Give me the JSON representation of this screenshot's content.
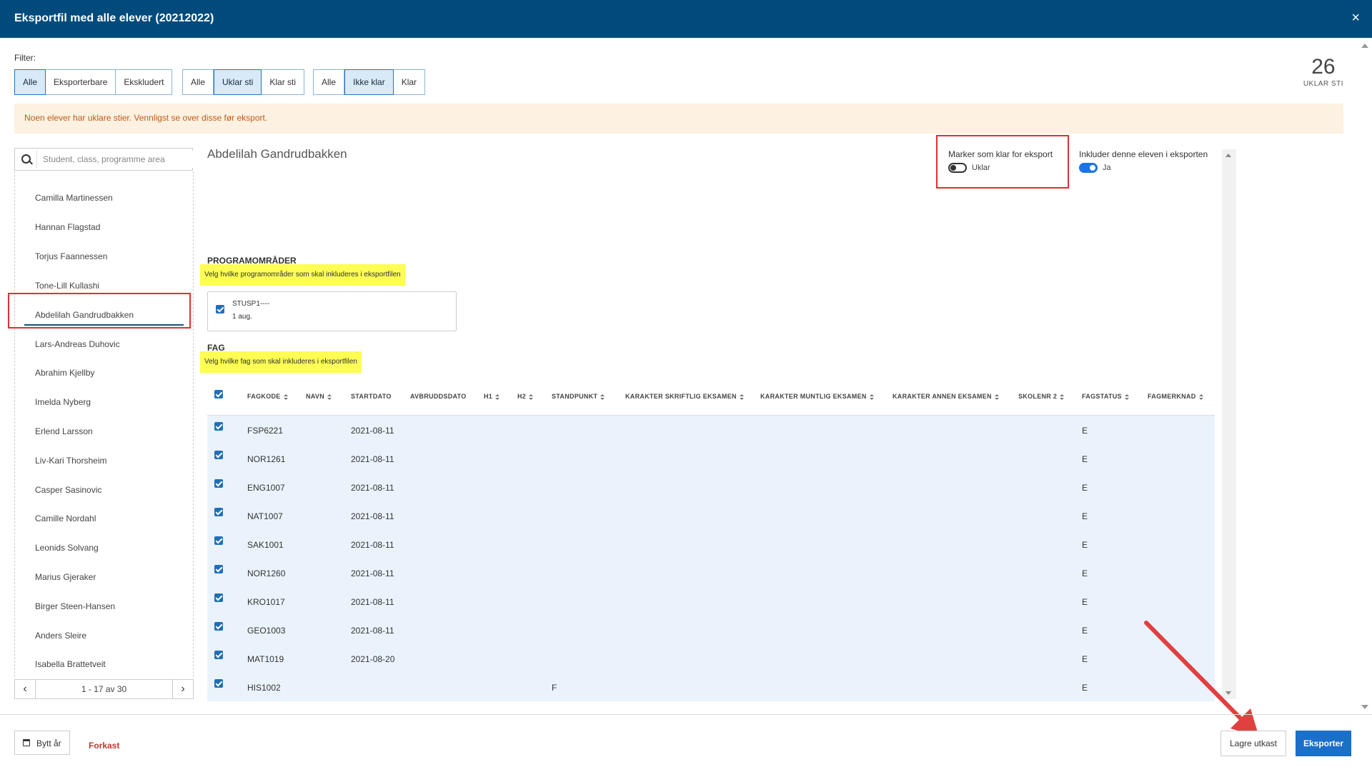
{
  "window": {
    "title": "Eksportfil med alle elever (20212022)",
    "close": "×"
  },
  "filter": {
    "label": "Filter:",
    "group1": [
      "Alle",
      "Eksporterbare",
      "Ekskludert"
    ],
    "group2": [
      "Alle",
      "Uklar sti",
      "Klar sti"
    ],
    "group3": [
      "Alle",
      "Ikke klar",
      "Klar"
    ],
    "active": {
      "group1": "Alle",
      "group2": "Uklar sti",
      "group3": "Ikke klar"
    }
  },
  "counter": {
    "value": "26",
    "label": "UKLAR STI"
  },
  "alert": "Noen elever har uklare stier. Vennligst se over disse før eksport.",
  "sidebar": {
    "search_placeholder": "Student, class, programme area",
    "students": [
      "Camilla Martinessen",
      "Hannan Flagstad",
      "Torjus Faannessen",
      "Tone-Lill Kullashi",
      "Abdelilah Gandrudbakken",
      "Lars-Andreas Duhovic",
      "Abrahim Kjellby",
      "Imelda Nyberg",
      "Erlend Larsson",
      "Liv-Kari Thorsheim",
      "Casper Sasinovic",
      "Camille Nordahl",
      "Leonids Solvang",
      "Marius Gjeraker",
      "Birger Steen-Hansen",
      "Anders Sleire",
      "Isabella Brattetveit"
    ],
    "selected": "Abdelilah Gandrudbakken",
    "pager": "1 - 17 av 30"
  },
  "detail": {
    "student_name": "Abdelilah Gandrudbakken",
    "ready_toggle": {
      "label": "Marker som klar for eksport",
      "value": "Uklar",
      "on": false
    },
    "include_toggle": {
      "label": "Inkluder denne eleven i eksporten",
      "value": "Ja",
      "on": true
    },
    "programs_heading": "PROGRAMOMRÅDER",
    "programs_hint": "Velg hvilke programområder som skal inkluderes i eksportfilen",
    "program": {
      "code": "STUSP1----",
      "date": "1 aug."
    },
    "subjects_heading": "FAG",
    "subjects_hint": "Velg hvilke fag som skal inkluderes i eksportfilen"
  },
  "table": {
    "columns": [
      "FAGKODE",
      "NAVN",
      "STARTDATO",
      "AVBRUDDSDATO",
      "H1",
      "H2",
      "STANDPUNKT",
      "KARAKTER SKRIFTLIG EKSAMEN",
      "KARAKTER MUNTLIG EKSAMEN",
      "KARAKTER ANNEN EKSAMEN",
      "SKOLENR 2",
      "FAGSTATUS",
      "FAGMERKNAD"
    ],
    "rows": [
      {
        "code": "FSP6221",
        "start": "2021-08-11",
        "standpunkt": "",
        "status": "E"
      },
      {
        "code": "NOR1261",
        "start": "2021-08-11",
        "standpunkt": "",
        "status": "E"
      },
      {
        "code": "ENG1007",
        "start": "2021-08-11",
        "standpunkt": "",
        "status": "E"
      },
      {
        "code": "NAT1007",
        "start": "2021-08-11",
        "standpunkt": "",
        "status": "E"
      },
      {
        "code": "SAK1001",
        "start": "2021-08-11",
        "standpunkt": "",
        "status": "E"
      },
      {
        "code": "NOR1260",
        "start": "2021-08-11",
        "standpunkt": "",
        "status": "E"
      },
      {
        "code": "KRO1017",
        "start": "2021-08-11",
        "standpunkt": "",
        "status": "E"
      },
      {
        "code": "GEO1003",
        "start": "2021-08-11",
        "standpunkt": "",
        "status": "E"
      },
      {
        "code": "MAT1019",
        "start": "2021-08-20",
        "standpunkt": "",
        "status": "E"
      },
      {
        "code": "HIS1002",
        "start": "",
        "standpunkt": "F",
        "status": "E"
      }
    ]
  },
  "footer": {
    "change_year": "Bytt år",
    "discard": "Forkast",
    "save_draft": "Lagre utkast",
    "export": "Eksporter"
  },
  "colors": {
    "header": "#004b7c",
    "accent": "#1a6fc9",
    "alert_bg": "#fdf1e1",
    "highlight": "#fdfd54",
    "annotation": "#e03030"
  }
}
